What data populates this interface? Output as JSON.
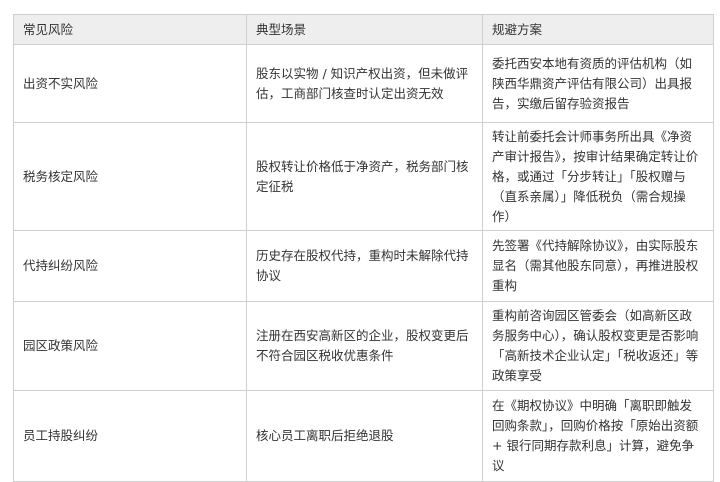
{
  "table": {
    "headers": [
      "常见风险",
      "典型场景",
      "规避方案"
    ],
    "rows": [
      {
        "risk": "出资不实风险",
        "scenario": "股东以实物 / 知识产权出资，但未做评估，工商部门核查时认定出资无效",
        "solution": "委托西安本地有资质的评估机构（如陕西华鼎资产评估有限公司）出具报告，实缴后留存验资报告"
      },
      {
        "risk": "税务核定风险",
        "scenario": "股权转让价格低于净资产，税务部门核定征税",
        "solution": "转让前委托会计师事务所出具《净资产审计报告》，按审计结果确定转让价格，或通过「分步转让」「股权赠与（直系亲属）」降低税负（需合规操作）"
      },
      {
        "risk": "代持纠纷风险",
        "scenario": "历史存在股权代持，重构时未解除代持协议",
        "solution": "先签署《代持解除协议》，由实际股东显名（需其他股东同意），再推进股权重构"
      },
      {
        "risk": "园区政策风险",
        "scenario": "注册在西安高新区的企业，股权变更后不符合园区税收优惠条件",
        "solution": "重构前咨询园区管委会（如高新区政务服务中心），确认股权变更是否影响「高新技术企业认定」「税收返还」等政策享受"
      },
      {
        "risk": "员工持股纠纷",
        "scenario": "核心员工离职后拒绝退股",
        "solution": "在《期权协议》中明确「离职即触发回购条款」，回购价格按「原始出资额 + 银行同期存款利息」计算，避免争议"
      }
    ]
  }
}
